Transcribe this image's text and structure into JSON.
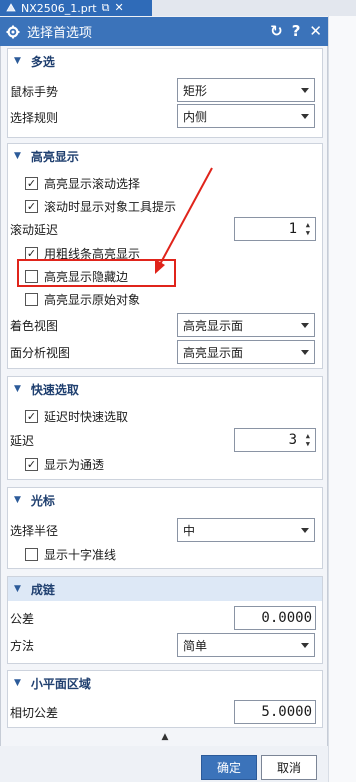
{
  "tab": {
    "title": "NX2506_1.prt",
    "actions": [
      "⧉",
      "✕"
    ]
  },
  "dialog": {
    "title": "选择首选项",
    "header_buttons": {
      "reset": "↻",
      "help": "?",
      "close": "✕"
    }
  },
  "groups": {
    "multi_select": {
      "title": "多选",
      "mouse_gesture_label": "鼠标手势",
      "mouse_gesture_value": "矩形",
      "select_rule_label": "选择规则",
      "select_rule_value": "内侧"
    },
    "highlight": {
      "title": "高亮显示",
      "cb_roll_select": {
        "label": "高亮显示滚动选择",
        "checked": true
      },
      "cb_tooltip": {
        "label": "滚动时显示对象工具提示",
        "checked": true
      },
      "scroll_delay_label": "滚动延迟",
      "scroll_delay_value": "1",
      "cb_thick_line": {
        "label": "用粗线条高亮显示",
        "checked": true
      },
      "cb_hidden_edges": {
        "label": "高亮显示隐藏边",
        "checked": false
      },
      "cb_original_object": {
        "label": "高亮显示原始对象",
        "checked": false
      },
      "shaded_view_label": "着色视图",
      "shaded_view_value": "高亮显示面",
      "face_analysis_label": "面分析视图",
      "face_analysis_value": "高亮显示面"
    },
    "quick_pick": {
      "title": "快速选取",
      "cb_delay_quick": {
        "label": "延迟时快速选取",
        "checked": true
      },
      "delay_label": "延迟",
      "delay_value": "3",
      "cb_show_pass": {
        "label": "显示为通透",
        "checked": true
      }
    },
    "cursor": {
      "title": "光标",
      "radius_label": "选择半径",
      "radius_value": "中",
      "cb_crosshair": {
        "label": "显示十字准线",
        "checked": false
      }
    },
    "chaining": {
      "title": "成链",
      "tolerance_label": "公差",
      "tolerance_value": "0.0000",
      "method_label": "方法",
      "method_value": "简单"
    },
    "facet": {
      "title": "小平面区域",
      "tangent_tolerance_label": "相切公差",
      "tangent_tolerance_value": "5.0000"
    }
  },
  "footer": {
    "ok_label": "确定",
    "cancel_label": "取消"
  },
  "colors": {
    "title_bar": "#3b73ba",
    "annotation_red": "#e0241b"
  }
}
